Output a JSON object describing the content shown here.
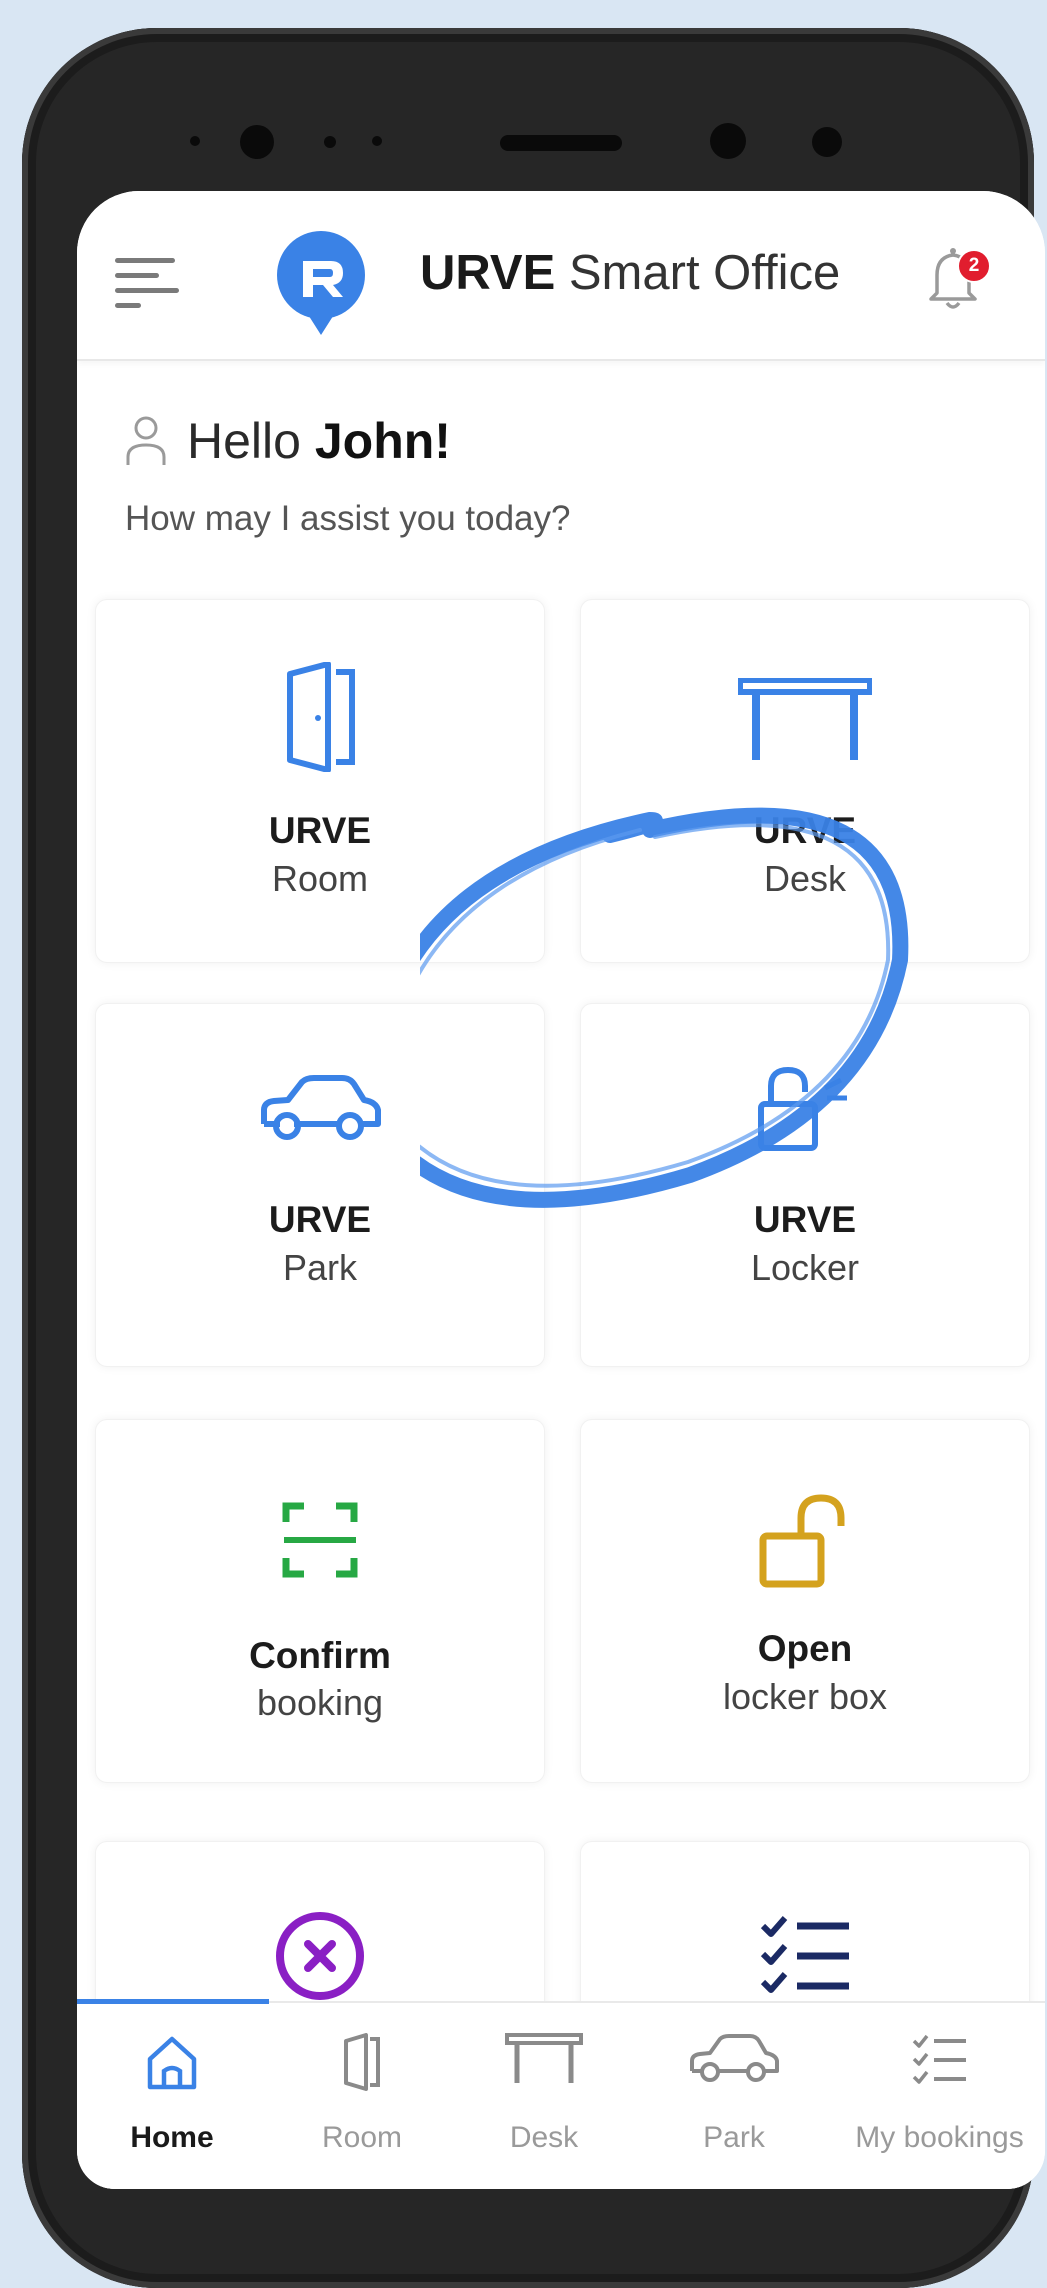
{
  "colors": {
    "accent": "#3a82e6",
    "confirm": "#27a844",
    "open": "#d4a21e",
    "cancel": "#8a1fc4",
    "bookings": "#1b2a64",
    "badge": "#e11d2e"
  },
  "header": {
    "brand": "URVE",
    "title_rest": " Smart Office",
    "notification_count": "2",
    "icons": [
      "menu-icon",
      "urve-logo",
      "bell-icon"
    ]
  },
  "greeting": {
    "hello": "Hello ",
    "name": "John!",
    "subtitle": "How may I assist you today?"
  },
  "tiles": [
    {
      "icon": "door-icon",
      "title": "URVE",
      "subtitle": "Room"
    },
    {
      "icon": "desk-icon",
      "title": "URVE",
      "subtitle": "Desk"
    },
    {
      "icon": "car-icon",
      "title": "URVE",
      "subtitle": "Park"
    },
    {
      "icon": "unlock-signal-icon",
      "title": "URVE",
      "subtitle": "Locker"
    },
    {
      "icon": "scan-icon",
      "title": "Confirm",
      "subtitle": "booking"
    },
    {
      "icon": "padlock-open-icon",
      "title": "Open",
      "subtitle": "locker box"
    },
    {
      "icon": "cancel-icon",
      "title": "",
      "subtitle": ""
    },
    {
      "icon": "checklist-icon",
      "title": "",
      "subtitle": ""
    }
  ],
  "bottom_nav": [
    {
      "icon": "home-icon",
      "label": "Home",
      "active": true
    },
    {
      "icon": "door-icon",
      "label": "Room",
      "active": false
    },
    {
      "icon": "desk-icon",
      "label": "Desk",
      "active": false
    },
    {
      "icon": "car-icon",
      "label": "Park",
      "active": false
    },
    {
      "icon": "checklist-icon",
      "label": "My bookings",
      "active": false
    }
  ]
}
